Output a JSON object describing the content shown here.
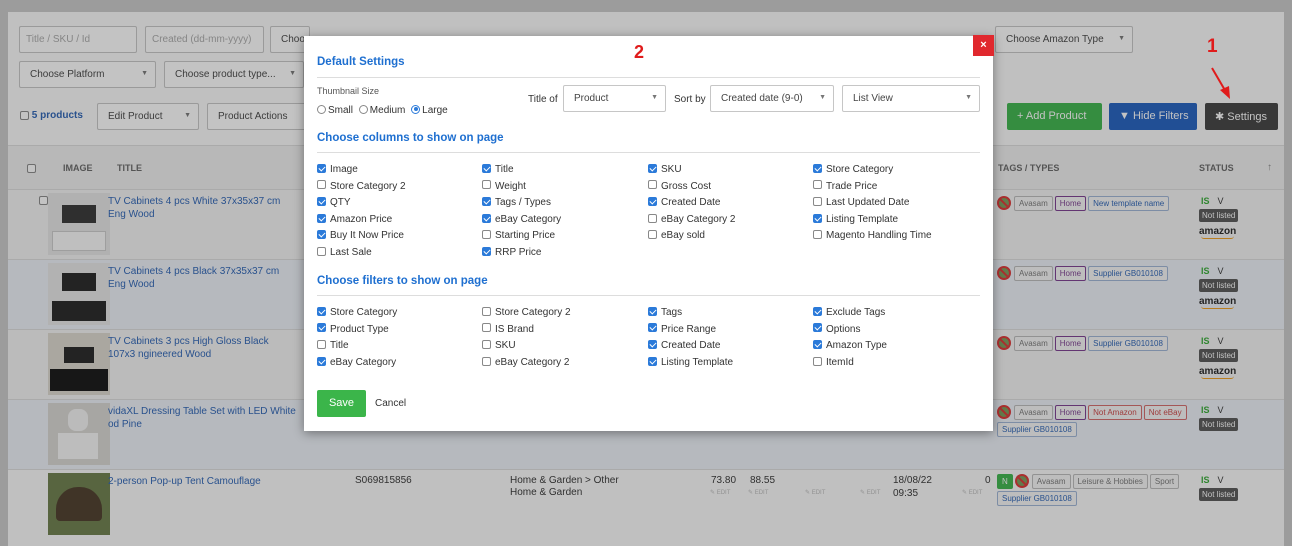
{
  "filters": {
    "search_placeholder": "Title / SKU / Id",
    "created_placeholder": "Created (dd-mm-yyyy)",
    "choose_partial": "Choo",
    "amazon_type": "Choose Amazon Type",
    "platform": "Choose Platform",
    "product_type": "Choose product type..."
  },
  "toolbar": {
    "products_count": "5 products",
    "edit_product": "Edit Product",
    "product_actions": "Product Actions",
    "add_product": "+ Add Product",
    "hide_filters": "Hide Filters",
    "settings": "Settings"
  },
  "table": {
    "headers": {
      "image": "IMAGE",
      "title": "TITLE",
      "tags": "TAGS / TYPES",
      "status": "STATUS",
      "sort_arrow": "↑"
    },
    "rows": [
      {
        "title": "TV Cabinets 4 pcs White 37x35x37 cm Eng Wood",
        "tags": [
          "Avasam",
          "Home",
          "New template name"
        ],
        "is": "IS",
        "v": "V",
        "status": "Not listed",
        "amazon": "amazon"
      },
      {
        "title": "TV Cabinets 4 pcs Black 37x35x37 cm Eng Wood",
        "tags": [
          "Avasam",
          "Home",
          "Supplier GB010108"
        ],
        "is": "IS",
        "v": "V",
        "status": "Not listed",
        "amazon": "amazon"
      },
      {
        "title": "TV Cabinets 3 pcs High Gloss Black 107x3 ngineered Wood",
        "tags": [
          "Avasam",
          "Home",
          "Supplier GB010108"
        ],
        "is": "IS",
        "v": "V",
        "status": "Not listed",
        "amazon": "amazon"
      },
      {
        "title": "vidaXL Dressing Table Set with LED White od Pine",
        "tags": [
          "Avasam",
          "Home",
          "Not Amazon",
          "Not eBay",
          "Supplier GB010108"
        ],
        "is": "IS",
        "v": "V",
        "status": "Not listed"
      },
      {
        "title": "2-person Pop-up Tent Camouflage",
        "sku": "S069815856",
        "category": "Home & Garden > Other Home & Garden",
        "price1": "73.80",
        "price2": "88.55",
        "edit": "EDIT",
        "date": "18/08/22",
        "time": "09:35",
        "qty": "0",
        "n_badge": "N",
        "tags": [
          "Avasam",
          "Leisure & Hobbies",
          "Sport",
          "Supplier GB010108"
        ],
        "is": "IS",
        "v": "V",
        "status": "Not listed"
      }
    ]
  },
  "modal": {
    "title": "Default Settings",
    "thumbnail_label": "Thumbnail Size",
    "thumb_options": [
      "Small",
      "Medium",
      "Large"
    ],
    "thumb_selected": "Large",
    "title_of_label": "Title of",
    "title_of_value": "Product",
    "sort_by_label": "Sort by",
    "sort_by_value": "Created date (9-0)",
    "view_value": "List View",
    "columns_heading": "Choose columns to show on page",
    "columns": [
      {
        "label": "Image",
        "checked": true
      },
      {
        "label": "Title",
        "checked": true
      },
      {
        "label": "SKU",
        "checked": true
      },
      {
        "label": "Store Category",
        "checked": true
      },
      {
        "label": "Store Category 2",
        "checked": false
      },
      {
        "label": "Weight",
        "checked": false
      },
      {
        "label": "Gross Cost",
        "checked": false
      },
      {
        "label": "Trade Price",
        "checked": false
      },
      {
        "label": "QTY",
        "checked": true
      },
      {
        "label": "Tags / Types",
        "checked": true
      },
      {
        "label": "Created Date",
        "checked": true
      },
      {
        "label": "Last Updated Date",
        "checked": false
      },
      {
        "label": "Amazon Price",
        "checked": true
      },
      {
        "label": "eBay Category",
        "checked": true
      },
      {
        "label": "eBay Category 2",
        "checked": false
      },
      {
        "label": "Listing Template",
        "checked": true
      },
      {
        "label": "Buy It Now Price",
        "checked": true
      },
      {
        "label": "Starting Price",
        "checked": false
      },
      {
        "label": "eBay sold",
        "checked": false
      },
      {
        "label": "Magento Handling Time",
        "checked": false
      },
      {
        "label": "Last Sale",
        "checked": false
      },
      {
        "label": "RRP Price",
        "checked": true
      }
    ],
    "filters_heading": "Choose filters to show on page",
    "filters": [
      {
        "label": "Store Category",
        "checked": true
      },
      {
        "label": "Store Category 2",
        "checked": false
      },
      {
        "label": "Tags",
        "checked": true
      },
      {
        "label": "Exclude Tags",
        "checked": true
      },
      {
        "label": "Product Type",
        "checked": true
      },
      {
        "label": "IS Brand",
        "checked": false
      },
      {
        "label": "Price Range",
        "checked": true
      },
      {
        "label": "Options",
        "checked": true
      },
      {
        "label": "Title",
        "checked": false
      },
      {
        "label": "SKU",
        "checked": false
      },
      {
        "label": "Created Date",
        "checked": true
      },
      {
        "label": "Amazon Type",
        "checked": true
      },
      {
        "label": "eBay Category",
        "checked": true
      },
      {
        "label": "eBay Category 2",
        "checked": false
      },
      {
        "label": "Listing Template",
        "checked": true
      },
      {
        "label": "ItemId",
        "checked": false
      }
    ],
    "save_label": "Save",
    "cancel_label": "Cancel",
    "close_label": "×"
  },
  "annotations": {
    "one": "1",
    "two": "2"
  },
  "colors": {
    "accent_blue": "#1e6fd0",
    "add_green": "#3bb54a",
    "hide_blue": "#1f5fbf",
    "settings_dark": "#3f3f3f",
    "close_red": "#e0282e"
  }
}
